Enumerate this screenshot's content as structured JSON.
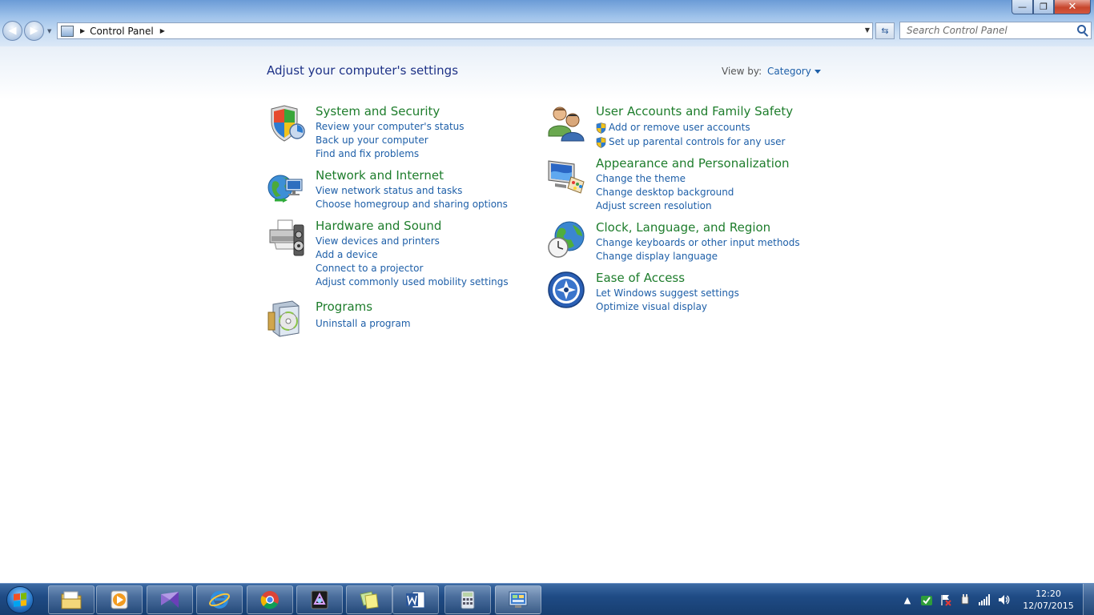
{
  "window": {
    "controls": {
      "minimize": "—",
      "maximize": "❐",
      "close": "✕"
    }
  },
  "navigation": {
    "back": "◀",
    "forward": "▶",
    "address": {
      "crumb_separator": "▶",
      "location": "Control Panel",
      "end_separator": "▶"
    },
    "refresh_glyph": "⇆",
    "search": {
      "placeholder": "Search Control Panel"
    }
  },
  "main": {
    "heading": "Adjust your computer's settings",
    "view_by_label": "View by:",
    "view_by_value": "Category",
    "categories": [
      {
        "title": "System and Security",
        "icon": "shield-icon",
        "links": [
          "Review your computer's status",
          "Back up your computer",
          "Find and fix problems"
        ]
      },
      {
        "title": "Network and Internet",
        "icon": "network-globe-icon",
        "links": [
          "View network status and tasks",
          "Choose homegroup and sharing options"
        ]
      },
      {
        "title": "Hardware and Sound",
        "icon": "printer-speaker-icon",
        "links": [
          "View devices and printers",
          "Add a device",
          "Connect to a projector",
          "Adjust commonly used mobility settings"
        ]
      },
      {
        "title": "Programs",
        "icon": "programs-disc-icon",
        "links": [
          "Uninstall a program"
        ]
      },
      {
        "title": "User Accounts and Family Safety",
        "icon": "users-icon",
        "links": [
          "Add or remove user accounts",
          "Set up parental controls for any user"
        ]
      },
      {
        "title": "Appearance and Personalization",
        "icon": "monitor-palette-icon",
        "links": [
          "Change the theme",
          "Change desktop background",
          "Adjust screen resolution"
        ]
      },
      {
        "title": "Clock, Language, and Region",
        "icon": "clock-globe-icon",
        "links": [
          "Change keyboards or other input methods",
          "Change display language"
        ]
      },
      {
        "title": "Ease of Access",
        "icon": "ease-of-access-icon",
        "links": [
          "Let Windows suggest settings",
          "Optimize visual display"
        ]
      }
    ]
  },
  "taskbar": {
    "pinned": [
      {
        "icon": "file-explorer-icon"
      },
      {
        "icon": "media-player-icon"
      },
      {
        "icon": "visual-studio-icon"
      },
      {
        "icon": "internet-explorer-icon"
      },
      {
        "icon": "chrome-icon"
      },
      {
        "icon": "media-app-icon"
      },
      {
        "icon": "sticky-notes-icon"
      },
      {
        "icon": "word-icon"
      },
      {
        "icon": "calculator-icon"
      },
      {
        "icon": "control-panel-icon"
      }
    ],
    "tray": {
      "show_hidden": "▲",
      "icons": [
        "sync-check-icon",
        "flag-error-icon",
        "power-plug-icon",
        "network-signal-icon",
        "volume-icon"
      ]
    },
    "clock": {
      "time": "12:20",
      "date": "12/07/2015"
    }
  }
}
